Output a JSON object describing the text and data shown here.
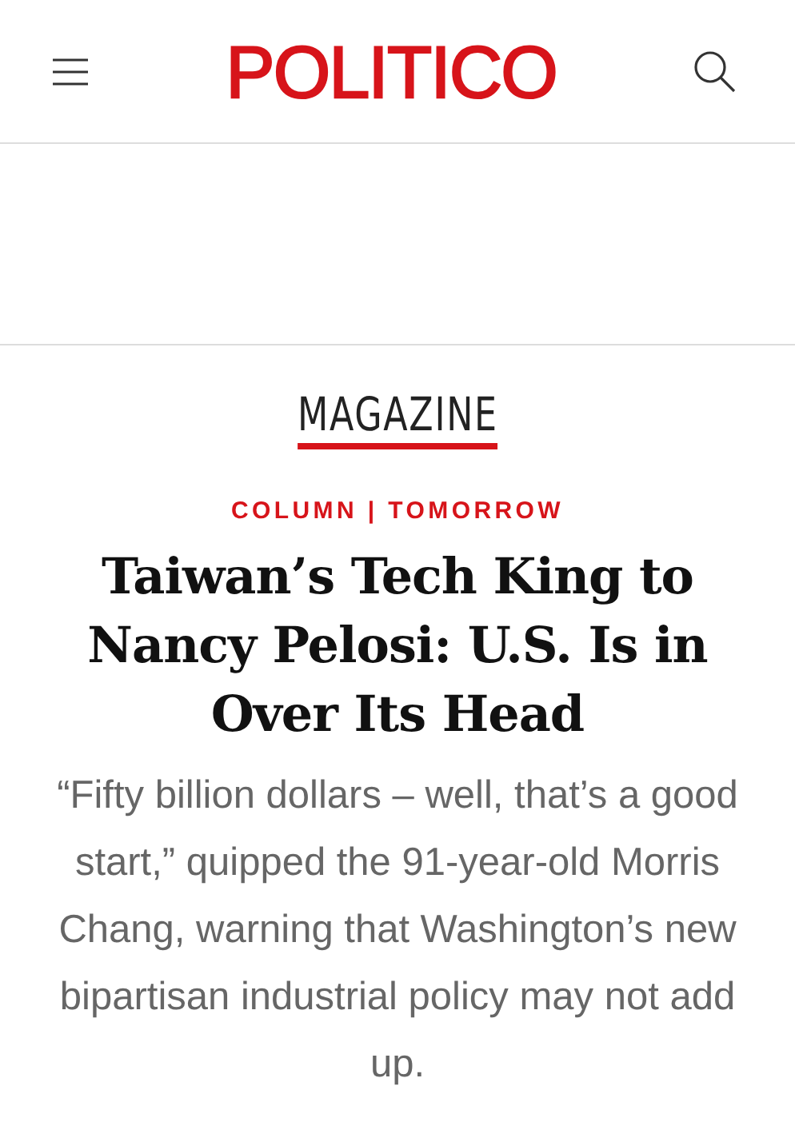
{
  "header": {
    "logo": "POLITICO"
  },
  "section": {
    "label": "MAGAZINE"
  },
  "article": {
    "kicker": "COLUMN | TOMORROW",
    "headline": "Taiwan’s Tech King to Nancy Pelosi: U.S. Is in Over Its Head",
    "deck": "“Fifty billion dollars – well, that’s a good start,” quipped the 91-year-old Morris Chang, warning that Washington’s new bipartisan industrial policy may not add up."
  }
}
